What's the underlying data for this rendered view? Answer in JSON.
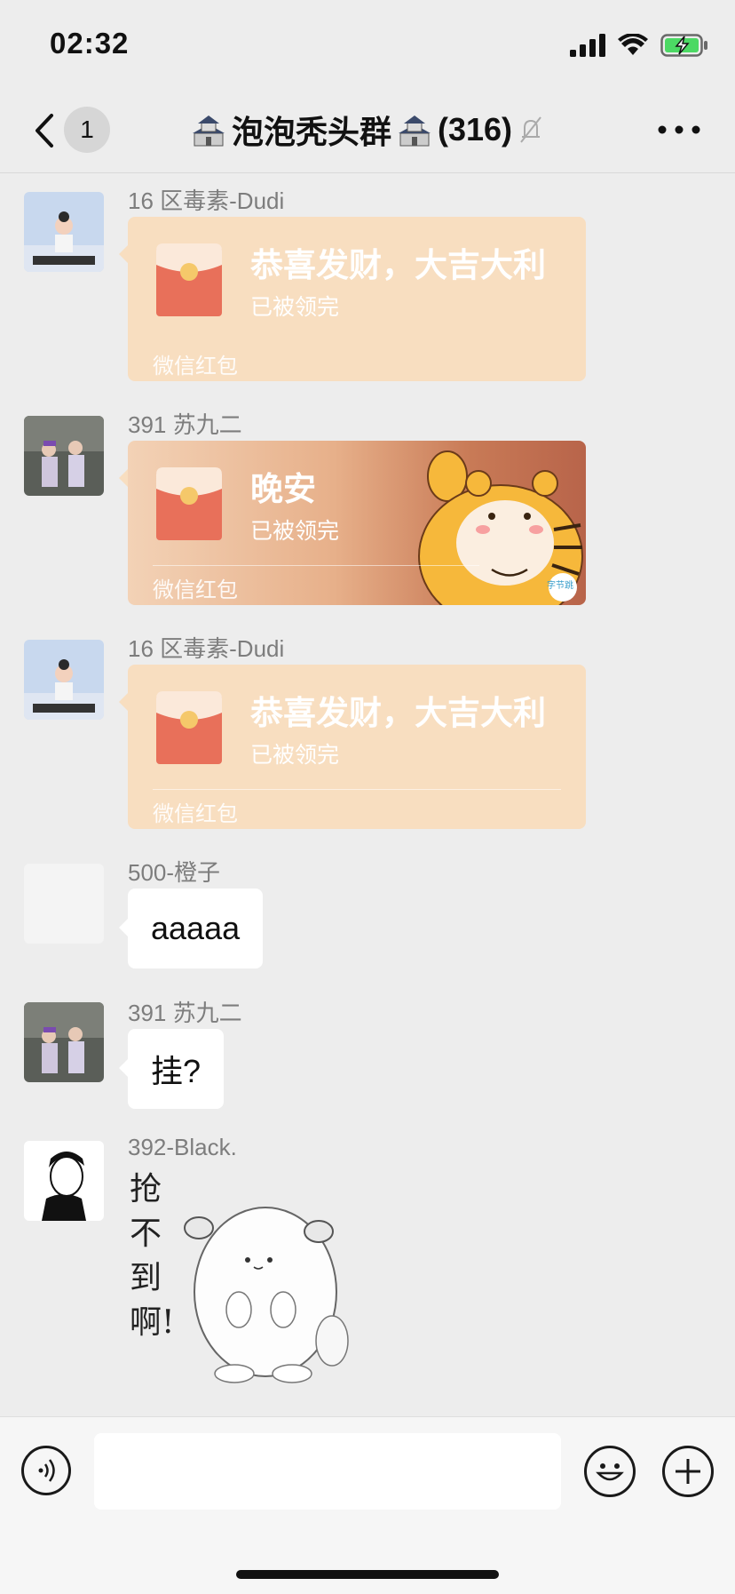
{
  "status_bar": {
    "time": "02:32"
  },
  "nav": {
    "unread_count": "1",
    "title": "泡泡秃头群",
    "member_count": "(316)"
  },
  "messages": [
    {
      "type": "red_packet",
      "sender": "16 区毒素-Dudi",
      "title": "恭喜发财，大吉大利",
      "status": "已被领完",
      "footer": "微信红包"
    },
    {
      "type": "red_packet",
      "sender": "391 苏九二",
      "title": "晚安",
      "status": "已被领完",
      "footer": "微信红包",
      "badge": "字节跳"
    },
    {
      "type": "red_packet",
      "sender": "16 区毒素-Dudi",
      "title": "恭喜发财，大吉大利",
      "status": "已被领完",
      "footer": "微信红包"
    },
    {
      "type": "text",
      "sender": "500-橙子",
      "text": "aaaaa"
    },
    {
      "type": "text",
      "sender": "391 苏九二",
      "text": "挂?"
    },
    {
      "type": "sticker",
      "sender": "392-Black.",
      "sticker_text": "抢不到啊!"
    }
  ],
  "colors": {
    "red_packet": "#f8dec0",
    "envelope": "#e8705a",
    "background": "#ededed"
  }
}
